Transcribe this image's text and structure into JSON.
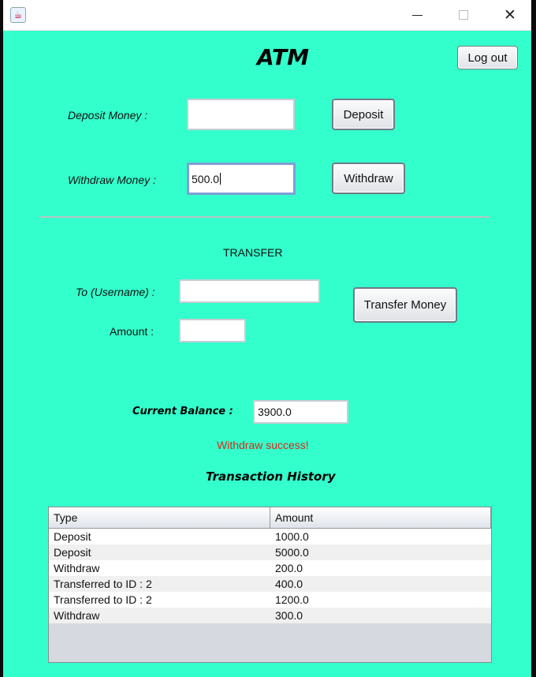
{
  "window": {
    "icon": "java-coffee-icon",
    "controls": {
      "minimize": "minimize-icon",
      "maximize": "maximize-icon",
      "close": "close-icon"
    }
  },
  "header": {
    "title": "ATM",
    "logout_label": "Log out"
  },
  "deposit": {
    "label": "Deposit Money :",
    "value": "",
    "button_label": "Deposit"
  },
  "withdraw": {
    "label": "Withdraw Money :",
    "value": "500.0",
    "button_label": "Withdraw"
  },
  "transfer": {
    "section_title": "TRANSFER",
    "to_label": "To (Username) :",
    "to_value": "",
    "amount_label": "Amount :",
    "amount_value": "",
    "button_label": "Transfer Money"
  },
  "balance": {
    "label": "Current Balance :",
    "value": "3900.0"
  },
  "status": {
    "message": "Withdraw success!",
    "color": "#d42a1a"
  },
  "history": {
    "title": "Transaction History",
    "columns": [
      "Type",
      "Amount"
    ],
    "rows": [
      {
        "type": "Deposit",
        "amount": "1000.0"
      },
      {
        "type": "Deposit",
        "amount": "5000.0"
      },
      {
        "type": "Withdraw",
        "amount": "200.0"
      },
      {
        "type": "Transferred to ID : 2",
        "amount": "400.0"
      },
      {
        "type": "Transferred to ID : 2",
        "amount": "1200.0"
      },
      {
        "type": "Withdraw",
        "amount": "300.0"
      }
    ]
  },
  "colors": {
    "background": "#33ffcc",
    "button_border": "#7a7a7a",
    "focus_border": "#7f9fd6"
  }
}
